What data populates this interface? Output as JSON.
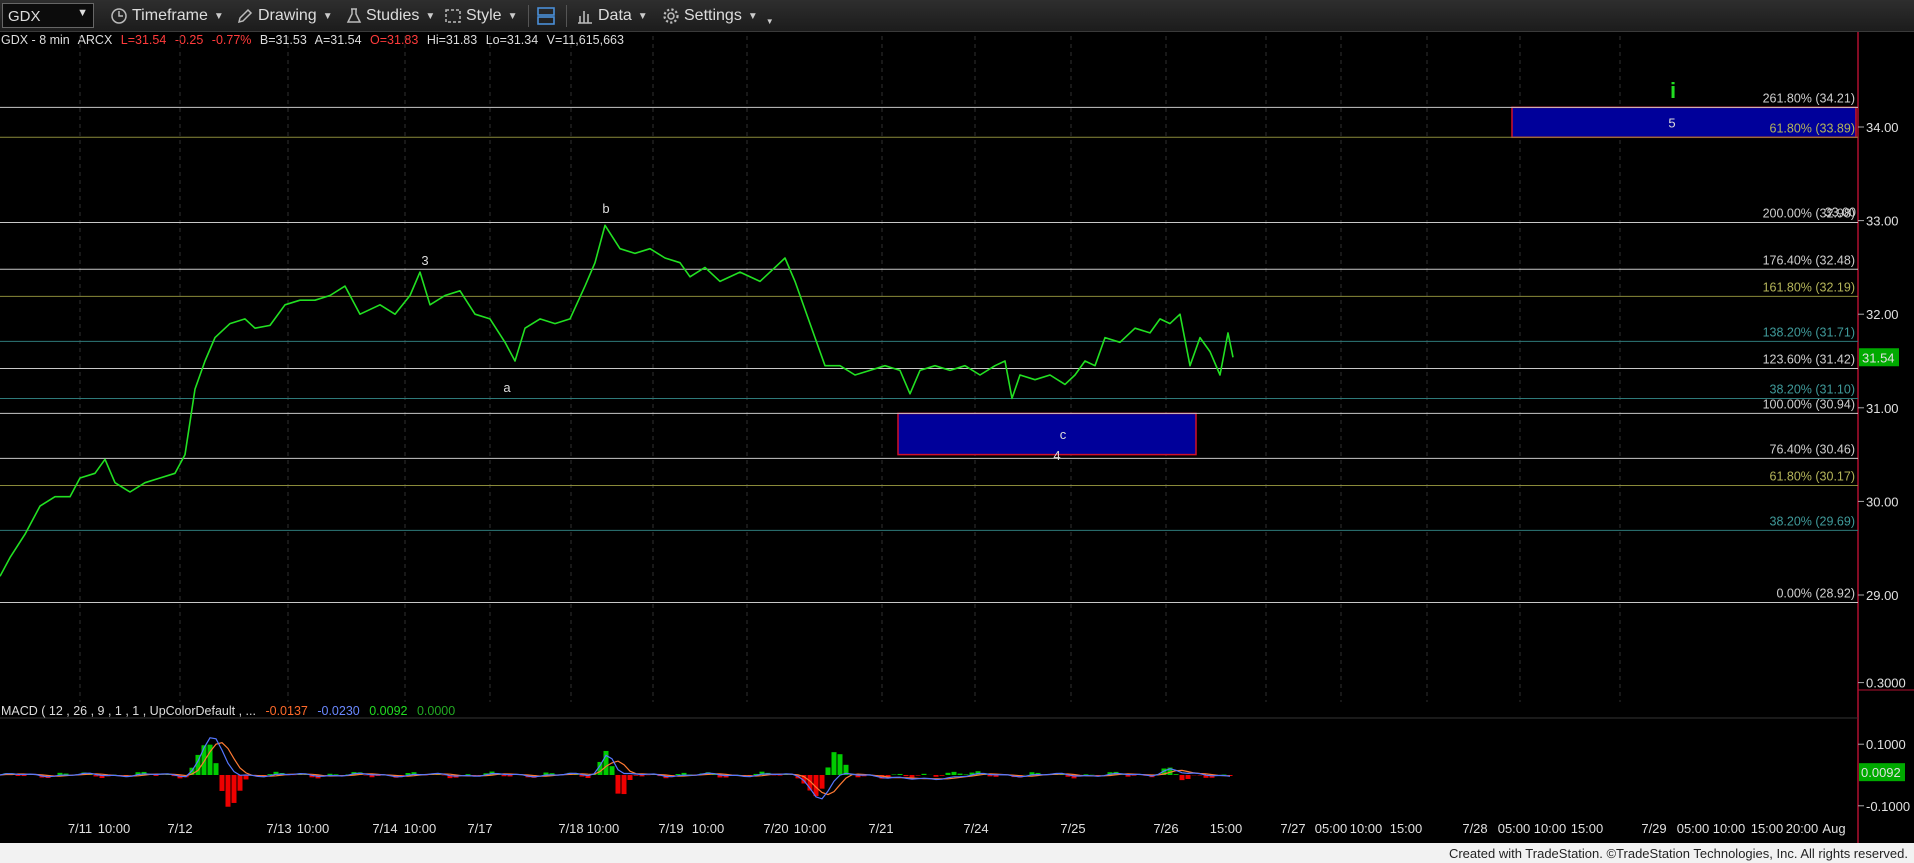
{
  "toolbar": {
    "symbol": "GDX",
    "timeframe": "Timeframe",
    "drawing": "Drawing",
    "studies": "Studies",
    "style": "Style",
    "data": "Data",
    "settings": "Settings"
  },
  "header": {
    "title": "GDX - 8 min",
    "exchange": "ARCX",
    "last": "L=31.54",
    "change": "-0.25",
    "change_pct": "-0.77%",
    "bid": "B=31.53",
    "ask": "A=31.54",
    "open": "O=31.83",
    "high": "Hi=31.83",
    "low": "Lo=31.34",
    "volume": "V=11,615,663"
  },
  "macd_header": {
    "title": "MACD ( 12 , 26 , 9 , 1 , 1 , UpColorDefault , ...",
    "v1": "-0.0137",
    "v2": "-0.0230",
    "v3": "0.0092",
    "v4": "0.0000"
  },
  "footer": "Created with TradeStation. ©TradeStation Technologies, Inc. All rights reserved.",
  "colors": {
    "price": "#22e022",
    "fib_white": "#c8c8c8",
    "fib_olive": "#8a8a3a",
    "fib_teal": "#2e7a7a",
    "target_box": "#00009a",
    "target_border": "#d0102a",
    "last_price_tag": "#00aa00",
    "macd_line": "#5577ff",
    "signal_line": "#ff7a33",
    "hist_pos": "#00cc00",
    "hist_neg": "#ee0000"
  },
  "chart_data": {
    "type": "line",
    "symbol": "GDX",
    "interval": "8 min",
    "ylim": [
      27.9,
      35.0
    ],
    "y_ticks": [
      "34.00",
      "33.00",
      "32.00",
      "31.00",
      "30.00",
      "29.00"
    ],
    "x_ticks": [
      "7/11",
      "10:00",
      "7/12",
      "7/13",
      "10:00",
      "7/14",
      "10:00",
      "7/17",
      "7/18",
      "10:00",
      "7/19",
      "10:00",
      "7/20",
      "10:00",
      "7/21",
      "7/24",
      "7/25",
      "7/26",
      "15:00",
      "7/27",
      "05:00",
      "10:00",
      "15:00",
      "7/28",
      "05:00",
      "10:00",
      "15:00",
      "7/29",
      "05:00",
      "10:00",
      "15:00",
      "20:00",
      "Aug"
    ],
    "series": [
      {
        "values": [
          [
            0,
            29.2
          ],
          [
            10,
            29.4
          ],
          [
            25,
            29.65
          ],
          [
            40,
            29.95
          ],
          [
            55,
            30.05
          ],
          [
            70,
            30.05
          ],
          [
            80,
            30.25
          ],
          [
            95,
            30.3
          ],
          [
            105,
            30.45
          ],
          [
            115,
            30.2
          ],
          [
            130,
            30.1
          ],
          [
            145,
            30.2
          ],
          [
            160,
            30.25
          ],
          [
            175,
            30.3
          ],
          [
            185,
            30.5
          ],
          [
            195,
            31.2
          ],
          [
            205,
            31.5
          ],
          [
            215,
            31.75
          ],
          [
            230,
            31.9
          ],
          [
            245,
            31.95
          ],
          [
            255,
            31.85
          ],
          [
            270,
            31.88
          ],
          [
            285,
            32.1
          ],
          [
            300,
            32.15
          ],
          [
            315,
            32.15
          ],
          [
            330,
            32.2
          ],
          [
            345,
            32.3
          ],
          [
            360,
            32.0
          ],
          [
            380,
            32.1
          ],
          [
            395,
            32.0
          ],
          [
            410,
            32.2
          ],
          [
            420,
            32.45
          ],
          [
            430,
            32.1
          ],
          [
            445,
            32.2
          ],
          [
            460,
            32.25
          ],
          [
            475,
            32.0
          ],
          [
            490,
            31.95
          ],
          [
            505,
            31.7
          ],
          [
            515,
            31.5
          ],
          [
            525,
            31.85
          ],
          [
            540,
            31.95
          ],
          [
            555,
            31.9
          ],
          [
            570,
            31.95
          ],
          [
            585,
            32.3
          ],
          [
            595,
            32.55
          ],
          [
            605,
            32.95
          ],
          [
            620,
            32.7
          ],
          [
            635,
            32.65
          ],
          [
            650,
            32.7
          ],
          [
            665,
            32.6
          ],
          [
            680,
            32.55
          ],
          [
            690,
            32.4
          ],
          [
            705,
            32.5
          ],
          [
            720,
            32.35
          ],
          [
            740,
            32.45
          ],
          [
            760,
            32.35
          ],
          [
            775,
            32.5
          ],
          [
            785,
            32.6
          ],
          [
            795,
            32.35
          ],
          [
            805,
            32.05
          ],
          [
            815,
            31.75
          ],
          [
            825,
            31.45
          ],
          [
            840,
            31.45
          ],
          [
            855,
            31.35
          ],
          [
            870,
            31.4
          ],
          [
            885,
            31.45
          ],
          [
            900,
            31.4
          ],
          [
            910,
            31.15
          ],
          [
            920,
            31.4
          ],
          [
            935,
            31.45
          ],
          [
            950,
            31.4
          ],
          [
            965,
            31.45
          ],
          [
            980,
            31.35
          ],
          [
            995,
            31.45
          ],
          [
            1005,
            31.5
          ],
          [
            1012,
            31.1
          ],
          [
            1020,
            31.35
          ],
          [
            1035,
            31.3
          ],
          [
            1050,
            31.35
          ],
          [
            1065,
            31.25
          ],
          [
            1075,
            31.35
          ],
          [
            1085,
            31.5
          ],
          [
            1095,
            31.45
          ],
          [
            1105,
            31.75
          ],
          [
            1120,
            31.7
          ],
          [
            1135,
            31.85
          ],
          [
            1150,
            31.8
          ],
          [
            1160,
            31.95
          ],
          [
            1170,
            31.9
          ],
          [
            1180,
            32.0
          ],
          [
            1190,
            31.45
          ],
          [
            1200,
            31.75
          ],
          [
            1210,
            31.6
          ],
          [
            1220,
            31.35
          ],
          [
            1228,
            31.8
          ],
          [
            1233,
            31.54
          ]
        ]
      }
    ],
    "fib_levels": [
      {
        "label": "261.80% (34.21)",
        "value": 34.21,
        "color": "white"
      },
      {
        "label": "61.80% (33.89)",
        "value": 33.89,
        "color": "olive"
      },
      {
        "label": "200.00% (32.98)",
        "value": 32.98,
        "color": "white"
      },
      {
        "label": "176.40% (32.48)",
        "value": 32.48,
        "color": "white"
      },
      {
        "label": "161.80% (32.19)",
        "value": 32.19,
        "color": "olive"
      },
      {
        "label": "138.20% (31.71)",
        "value": 31.71,
        "color": "teal"
      },
      {
        "label": "123.60% (31.42)",
        "value": 31.42,
        "color": "white"
      },
      {
        "label": "38.20% (31.10)",
        "value": 31.1,
        "color": "teal"
      },
      {
        "label": "100.00% (30.94)",
        "value": 30.94,
        "color": "white"
      },
      {
        "label": "76.40% (30.46)",
        "value": 30.46,
        "color": "white"
      },
      {
        "label": "61.80% (30.17)",
        "value": 30.17,
        "color": "olive"
      },
      {
        "label": "38.20% (29.69)",
        "value": 29.69,
        "color": "teal"
      },
      {
        "label": "0.00% (28.92)",
        "value": 28.92,
        "color": "white"
      }
    ],
    "target_zones": [
      {
        "label": "5",
        "ymin": 33.89,
        "ymax": 34.21
      },
      {
        "label": "c",
        "ymin": 30.5,
        "ymax": 30.94
      }
    ],
    "wave_labels": [
      "3",
      "a",
      "b",
      "4",
      "i"
    ],
    "level_readout": "33.00",
    "last_price": "31.54",
    "macd_ticks": [
      "0.3000",
      "0.1000",
      "-0.1000"
    ],
    "macd_value": "0.0092"
  }
}
